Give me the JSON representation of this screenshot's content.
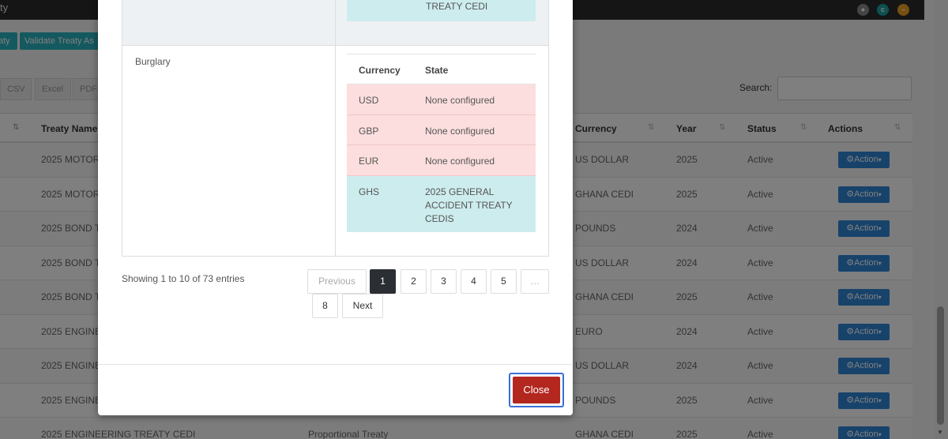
{
  "app": {
    "title_fragment": "ty",
    "top_icons": [
      "settings-icon",
      "profile-icon",
      "minimize-icon"
    ],
    "toolbar_buttons": [
      "aty",
      "Validate Treaty As"
    ],
    "export_buttons": [
      "CSV",
      "Excel",
      "PDF"
    ],
    "search_label": "Search:",
    "search_value": ""
  },
  "table": {
    "headers": [
      "Treaty Name",
      "Currency",
      "Year",
      "Status",
      "Actions"
    ],
    "rows": [
      {
        "name": "2025 MOTOR",
        "type": "",
        "currency": "US DOLLAR",
        "year": "2025",
        "status": "Active",
        "action": "Action"
      },
      {
        "name": "2025 MOTOR",
        "type": "",
        "currency": "GHANA CEDI",
        "year": "2025",
        "status": "Active",
        "action": "Action"
      },
      {
        "name": "2025 BOND T",
        "type": "",
        "currency": "POUNDS",
        "year": "2024",
        "status": "Active",
        "action": "Action"
      },
      {
        "name": "2025 BOND T",
        "type": "",
        "currency": "US DOLLAR",
        "year": "2024",
        "status": "Active",
        "action": "Action"
      },
      {
        "name": "2025 BOND T",
        "type": "",
        "currency": "GHANA CEDI",
        "year": "2025",
        "status": "Active",
        "action": "Action"
      },
      {
        "name": "2025 ENGINE",
        "type": "",
        "currency": "EURO",
        "year": "2024",
        "status": "Active",
        "action": "Action"
      },
      {
        "name": "2025 ENGINE",
        "type": "",
        "currency": "US DOLLAR",
        "year": "2024",
        "status": "Active",
        "action": "Action"
      },
      {
        "name": "2025 ENGINE",
        "type": "",
        "currency": "POUNDS",
        "year": "2025",
        "status": "Active",
        "action": "Action"
      },
      {
        "name": "2025 ENGINEERING TREATY CEDI",
        "type": "Proportional Treaty",
        "currency": "GHANA CEDI",
        "year": "2025",
        "status": "Active",
        "action": "Action"
      }
    ]
  },
  "modal": {
    "top_cell_text": "TREATY CEDI",
    "section_label": "Burglary",
    "sub_table": {
      "headers": [
        "Currency",
        "State"
      ],
      "rows": [
        {
          "currency": "USD",
          "state": "None configured",
          "status_color": "#fddede"
        },
        {
          "currency": "GBP",
          "state": "None configured",
          "status_color": "#fddede"
        },
        {
          "currency": "EUR",
          "state": "None configured",
          "status_color": "#fddede"
        },
        {
          "currency": "GHS",
          "state": "2025 GENERAL ACCIDENT TREATY CEDIS",
          "status_color": "#cdeced"
        }
      ]
    },
    "showing_text": "Showing 1 to 10 of 73 entries",
    "pagination": {
      "previous": "Previous",
      "pages": [
        "1",
        "2",
        "3",
        "4",
        "5",
        "…",
        "8"
      ],
      "active": "1",
      "next": "Next"
    },
    "close_label": "Close"
  }
}
